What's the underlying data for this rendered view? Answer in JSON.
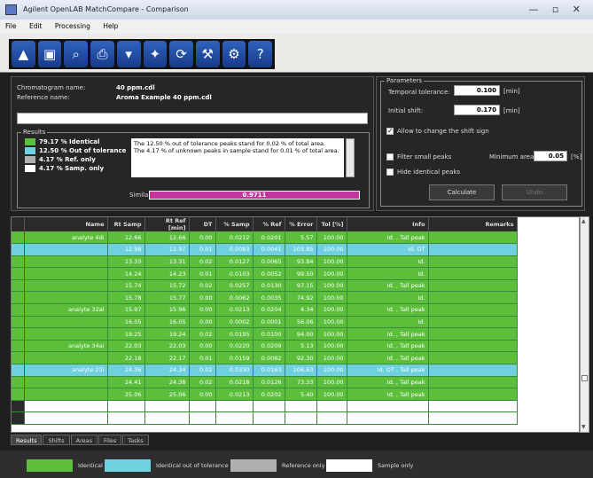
{
  "window": {
    "title": "Agilent OpenLAB MatchCompare - Comparison"
  },
  "menu": [
    "File",
    "Edit",
    "Processing",
    "Help"
  ],
  "toolbar_icons": [
    "open-icon",
    "save-icon",
    "search-icon",
    "print-icon",
    "export-icon",
    "compare-icon",
    "recalc-icon",
    "tools-icon",
    "settings-icon",
    "help-icon"
  ],
  "toolbar_glyphs": [
    "▲",
    "▣",
    "⌕",
    "⎙",
    "▾",
    "✦",
    "⟳",
    "⚒",
    "⚙",
    "?"
  ],
  "info": {
    "chromatogram_label": "Chromatogram name:",
    "chromatogram_value": "40 ppm.cdl",
    "reference_label": "Reference name:",
    "reference_value": "Aroma Example 40 ppm.cdl"
  },
  "results": {
    "title": "Results",
    "legend": [
      {
        "text": "79.17 % Identical",
        "color": "#5cbf3c"
      },
      {
        "text": "12.50 % Out of tolerance",
        "color": "#6fd0e0"
      },
      {
        "text": "4.17 % Ref. only",
        "color": "#b0b0b0"
      },
      {
        "text": "4.17 % Samp. only",
        "color": "#ffffff"
      }
    ],
    "message_1": "The 12.50 % out of tolerance peaks stand for 0.02 % of total area.",
    "message_2": "The 4.17 % of unknown peaks in sample stand for 0.01 % of total area.",
    "similarity_label": "Similarity",
    "similarity_value": "0.9711"
  },
  "parameters": {
    "title": "Parameters",
    "temporal_tolerance_label": "Temporal tolerance:",
    "temporal_tolerance_value": "0.100",
    "temporal_tolerance_unit": "[min]",
    "initial_shift_label": "Initial shift:",
    "initial_shift_value": "0.170",
    "initial_shift_unit": "[min]",
    "allow_shift_sign_label": "Allow to change the shift sign",
    "filter_small_label": "Filter small peaks",
    "minimum_area_label": "Minimum area:",
    "minimum_area_value": "0.05",
    "minimum_area_unit": "[%]",
    "hide_identical_label": "Hide identical peaks",
    "calculate_label": "Calculate",
    "undo_label": "Undo"
  },
  "table": {
    "headers": [
      "Name",
      "Rt Samp",
      "Rt Ref [min]",
      "DT",
      "% Samp",
      "% Ref",
      "% Error",
      "Tol [%]",
      "Info",
      "Remarks"
    ],
    "rows": [
      {
        "status": "g",
        "cells": [
          "analyte 4di",
          "12.66",
          "12.66",
          "0.00",
          "0.0212",
          "0.0201",
          "5.57",
          "100.00",
          "Id. , Tall peak",
          ""
        ]
      },
      {
        "status": "c",
        "cells": [
          "",
          "12.98",
          "12.97",
          "0.01",
          "0.0083",
          "0.0041",
          "103.85",
          "100.00",
          "Id. OT",
          ""
        ]
      },
      {
        "status": "g",
        "cells": [
          "",
          "13.33",
          "13.31",
          "0.02",
          "0.0127",
          "0.0065",
          "93.84",
          "100.00",
          "Id.",
          ""
        ]
      },
      {
        "status": "g",
        "cells": [
          "",
          "14.24",
          "14.23",
          "0.01",
          "0.0103",
          "0.0052",
          "99.50",
          "100.00",
          "Id.",
          ""
        ]
      },
      {
        "status": "g",
        "cells": [
          "",
          "15.74",
          "15.72",
          "0.02",
          "0.0257",
          "0.0130",
          "97.15",
          "100.00",
          "Id. , Tall peak",
          ""
        ]
      },
      {
        "status": "g",
        "cells": [
          "",
          "15.78",
          "15.77",
          "0.00",
          "0.0062",
          "0.0035",
          "74.92",
          "100.00",
          "Id.",
          ""
        ]
      },
      {
        "status": "g",
        "cells": [
          "analyte 32al",
          "15.97",
          "15.96",
          "0.00",
          "0.0213",
          "0.0204",
          "4.34",
          "100.00",
          "Id. , Tall peak",
          ""
        ]
      },
      {
        "status": "g",
        "cells": [
          "",
          "16.05",
          "16.05",
          "0.00",
          "0.0002",
          "0.0001",
          "56.06",
          "100.00",
          "Id.",
          ""
        ]
      },
      {
        "status": "g",
        "cells": [
          "",
          "19.25",
          "19.24",
          "0.02",
          "0.0195",
          "0.0100",
          "94.00",
          "100.00",
          "Id. , Tall peak",
          ""
        ]
      },
      {
        "status": "g",
        "cells": [
          "analyte 34ai",
          "22.03",
          "22.03",
          "0.00",
          "0.0220",
          "0.0209",
          "5.13",
          "100.00",
          "Id. , Tall peak",
          ""
        ]
      },
      {
        "status": "g",
        "cells": [
          "",
          "22.18",
          "22.17",
          "0.01",
          "0.0159",
          "0.0082",
          "92.30",
          "100.00",
          "Id. , Tall peak",
          ""
        ]
      },
      {
        "status": "c",
        "cells": [
          "analyte 23i",
          "24.36",
          "24.34",
          "0.02",
          "0.0330",
          "0.0163",
          "106.63",
          "100.00",
          "Id. OT , Tall peak",
          ""
        ]
      },
      {
        "status": "g",
        "cells": [
          "",
          "24.41",
          "24.38",
          "0.02",
          "0.0218",
          "0.0126",
          "73.33",
          "100.00",
          "Id. , Tall peak",
          ""
        ]
      },
      {
        "status": "g",
        "cells": [
          "",
          "25.06",
          "25.06",
          "0.00",
          "0.0213",
          "0.0202",
          "5.40",
          "100.00",
          "Id. , Tall peak",
          ""
        ]
      }
    ]
  },
  "tabs": [
    "Results",
    "Shifts",
    "Areas",
    "Files",
    "Tasks"
  ],
  "bottom_legend": [
    {
      "text": "Identical",
      "color": "#5cbf3c"
    },
    {
      "text": "Identical out of tolerance",
      "color": "#6fd0e0"
    },
    {
      "text": "Reference only",
      "color": "#b0b0b0"
    },
    {
      "text": "Sample only",
      "color": "#ffffff"
    }
  ]
}
